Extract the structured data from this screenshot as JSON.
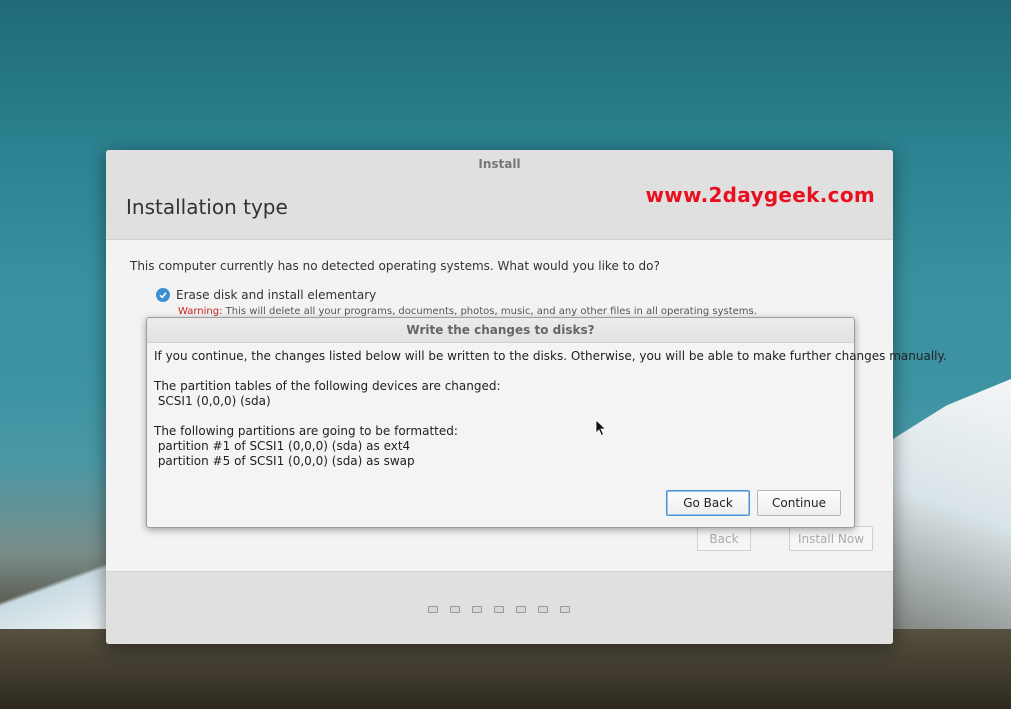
{
  "installer": {
    "window_title": "Install",
    "page_title": "Installation type",
    "watermark": "www.2daygeek.com",
    "question": "This computer currently has no detected operating systems. What would you like to do?",
    "option_erase": "Erase disk and install elementary",
    "warning_label": "Warning:",
    "warning_text": " This will delete all your programs, documents, photos, music, and any other files in all operating systems.",
    "back_label": "Back",
    "install_now_label": "Install Now",
    "steps_total": 7
  },
  "dialog": {
    "title": "Write the changes to disks?",
    "intro": "If you continue, the changes listed below will be written to the disks. Otherwise, you will be able to make further changes manually.",
    "tables_heading": "The partition tables of the following devices are changed:",
    "tables_items": [
      " SCSI1 (0,0,0) (sda)"
    ],
    "format_heading": "The following partitions are going to be formatted:",
    "format_items": [
      " partition #1 of SCSI1 (0,0,0) (sda) as ext4",
      " partition #5 of SCSI1 (0,0,0) (sda) as swap"
    ],
    "go_back_label": "Go Back",
    "continue_label": "Continue"
  },
  "colors": {
    "accent": "#3d8fd1",
    "watermark": "#e8101f",
    "warning": "#c0281f"
  },
  "icons": {
    "option_check": "check-circle-icon",
    "pointer": "mouse-pointer-icon"
  }
}
